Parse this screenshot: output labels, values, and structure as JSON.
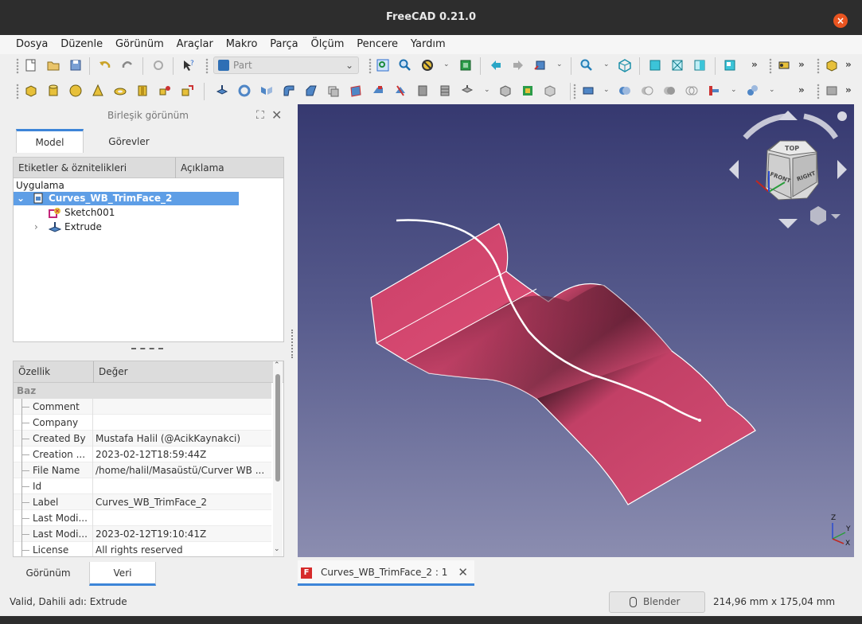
{
  "window": {
    "title": "FreeCAD 0.21.0",
    "close_glyph": "×"
  },
  "menu": [
    "Dosya",
    "Düzenle",
    "Görünüm",
    "Araçlar",
    "Makro",
    "Parça",
    "Ölçüm",
    "Pencere",
    "Yardım"
  ],
  "toolbar": {
    "workbench": "Part",
    "more": "»"
  },
  "combo_view": {
    "title": "Birleşik görünüm",
    "tabs": [
      "Model",
      "Görevler"
    ],
    "tree": {
      "columns": [
        "Etiketler & öznitelikleri",
        "Açıklama"
      ],
      "app_label": "Uygulama",
      "document": "Curves_WB_TrimFace_2",
      "items": [
        "Sketch001",
        "Extrude"
      ]
    },
    "props": {
      "columns": [
        "Özellik",
        "Değer"
      ],
      "group": "Baz",
      "rows": [
        {
          "key": "Comment",
          "value": ""
        },
        {
          "key": "Company",
          "value": ""
        },
        {
          "key": "Created By",
          "value": "Mustafa Halil (@AcikKaynakci)"
        },
        {
          "key": "Creation ...",
          "value": "2023-02-12T18:59:44Z"
        },
        {
          "key": "File Name",
          "value": "/home/halil/Masaüstü/Curver WB ..."
        },
        {
          "key": "Id",
          "value": ""
        },
        {
          "key": "Label",
          "value": "Curves_WB_TrimFace_2"
        },
        {
          "key": "Last Modi...",
          "value": ""
        },
        {
          "key": "Last Modi...",
          "value": "2023-02-12T19:10:41Z"
        },
        {
          "key": "License",
          "value": "All rights reserved"
        }
      ]
    },
    "bottom_tabs": [
      "Görünüm",
      "Veri"
    ]
  },
  "navcube": {
    "front": "FRONT",
    "right": "RIGHT",
    "top": "TOP"
  },
  "axes": {
    "x": "X",
    "y": "Y",
    "z": "Z"
  },
  "doc_tab": {
    "label": "Curves_WB_TrimFace_2 : 1",
    "close": "✕"
  },
  "status": {
    "message": "Valid, Dahili adı: Extrude",
    "nav_style": "Blender",
    "dimensions": "214,96 mm x 175,04 mm"
  },
  "colors": {
    "surface": "#d6476d",
    "selection": "#5e9ee6",
    "accent": "#3d85d8",
    "close": "#e95420"
  }
}
